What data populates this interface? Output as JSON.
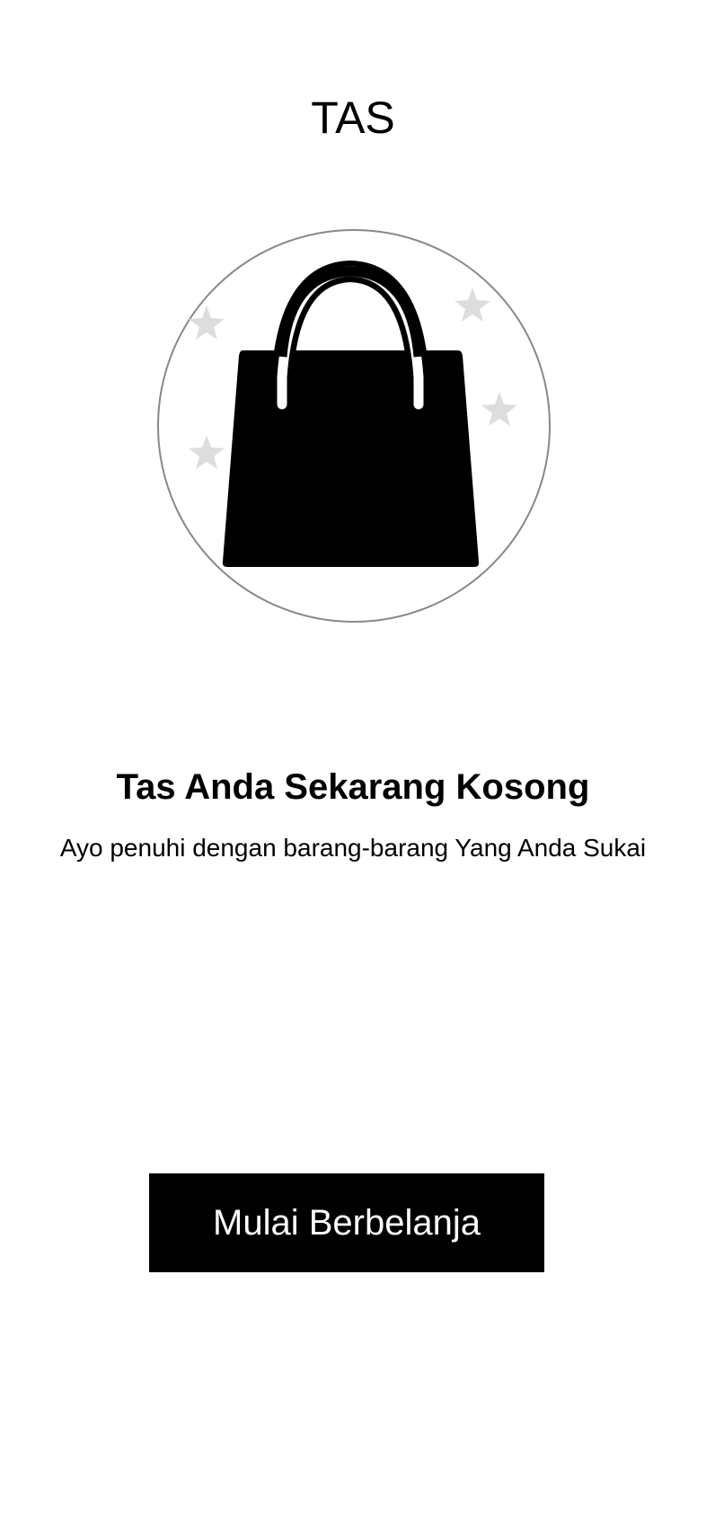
{
  "header": {
    "title": "TAS"
  },
  "illustration": {
    "icon": "shopping-bag-icon",
    "decoration_icons": [
      "star-icon",
      "star-icon",
      "star-icon",
      "star-icon"
    ],
    "colors": {
      "bag": "#000000",
      "circle_stroke": "#888888",
      "stars": "#dddddd"
    }
  },
  "empty_state": {
    "title": "Tas Anda Sekarang Kosong",
    "subtitle": "Ayo penuhi dengan barang-barang Yang Anda Sukai"
  },
  "cta": {
    "label": "Mulai Berbelanja",
    "background": "#000000",
    "text_color": "#ffffff"
  }
}
